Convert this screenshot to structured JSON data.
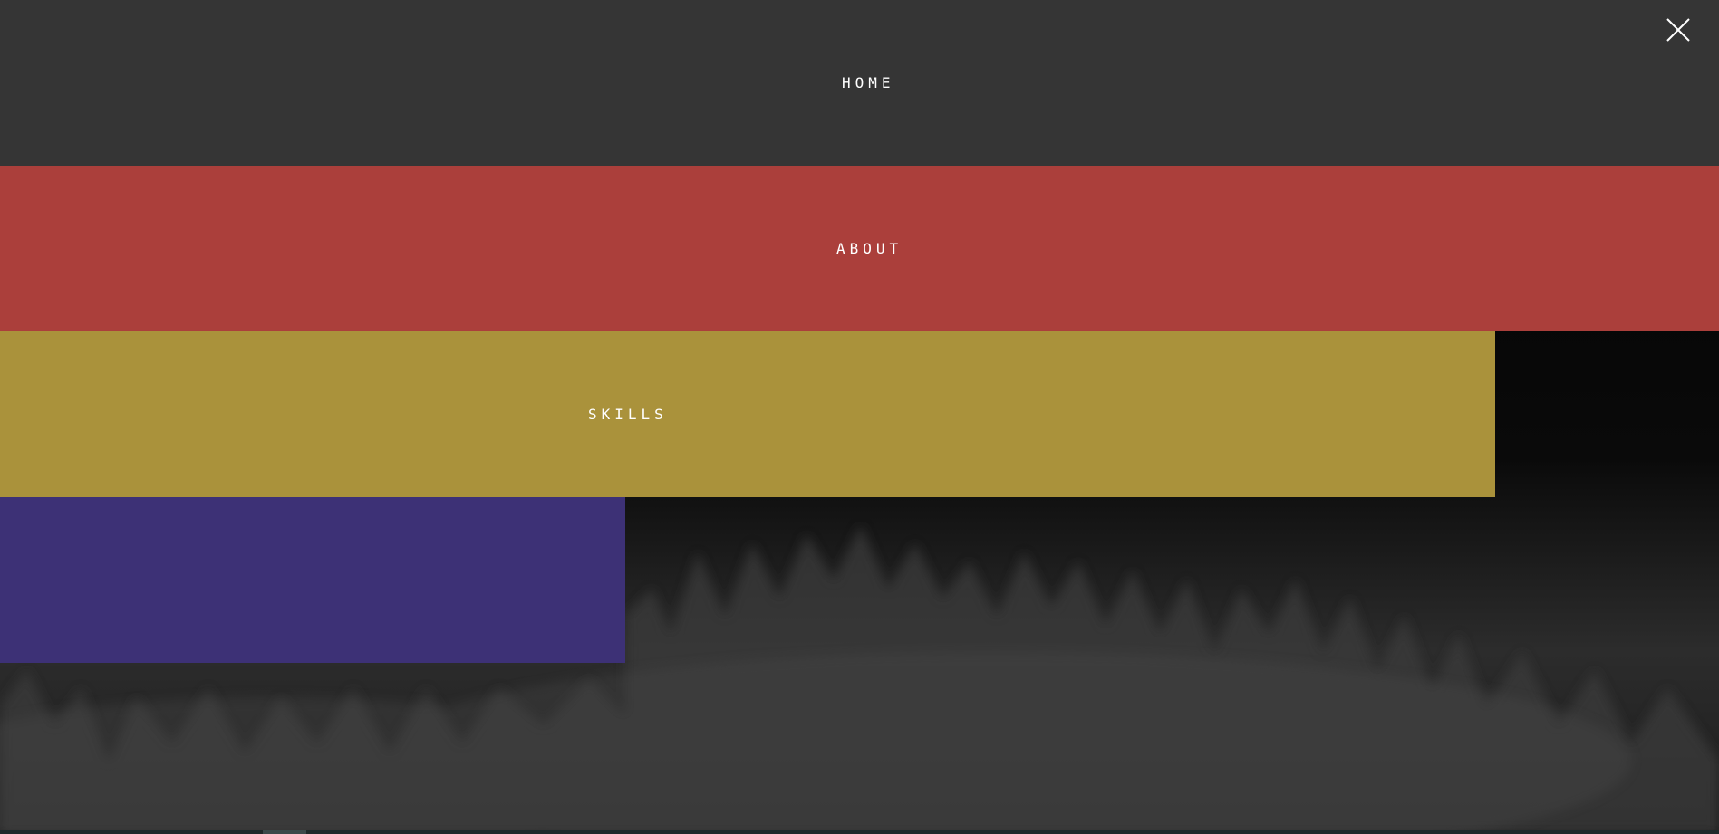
{
  "colors": {
    "home": "#353535",
    "about": "#ab3f3b",
    "skills": "#aa923b",
    "contact": "#3d3176",
    "label": "#ffffff"
  },
  "menu": {
    "items": [
      {
        "label": "HOME"
      },
      {
        "label": "ABOUT"
      },
      {
        "label": "SKILLS"
      },
      {
        "label": ""
      }
    ]
  },
  "icons": {
    "close": "close-icon"
  }
}
